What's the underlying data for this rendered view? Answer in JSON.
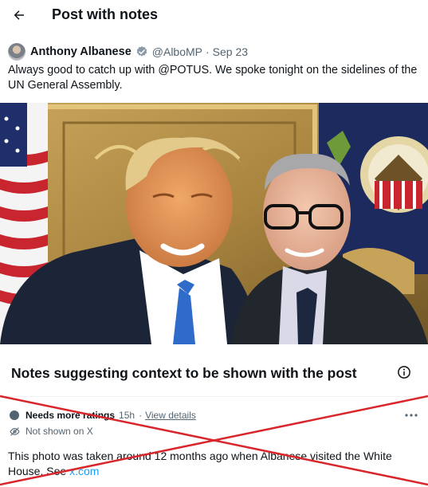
{
  "header": {
    "back_icon": "arrow-left-icon",
    "title": "Post with notes"
  },
  "post": {
    "author_name": "Anthony Albanese",
    "verified_icon": "verified-badge-icon",
    "verified_color": "#1d9bf0",
    "handle": "@AlboMP",
    "separator": "·",
    "date": "Sep 23",
    "text": "Always good to catch up with @POTUS. We spoke tonight on the sidelines of the UN General Assembly."
  },
  "notes": {
    "title": "Notes suggesting context to be shown with the post",
    "info_icon": "info-circle-icon",
    "note": {
      "status": "Needs more ratings",
      "time": "15h",
      "separator": "·",
      "view_details": "View details",
      "more_icon": "more-horizontal-icon",
      "shown_icon": "eye-off-icon",
      "shown_status": "Not shown on X",
      "text_before_link": "This photo was taken around 12 months ago when Albanese visited the White House. See ",
      "link_text": "x.com"
    }
  },
  "overlay": {
    "cross_color": "#d8262b"
  }
}
